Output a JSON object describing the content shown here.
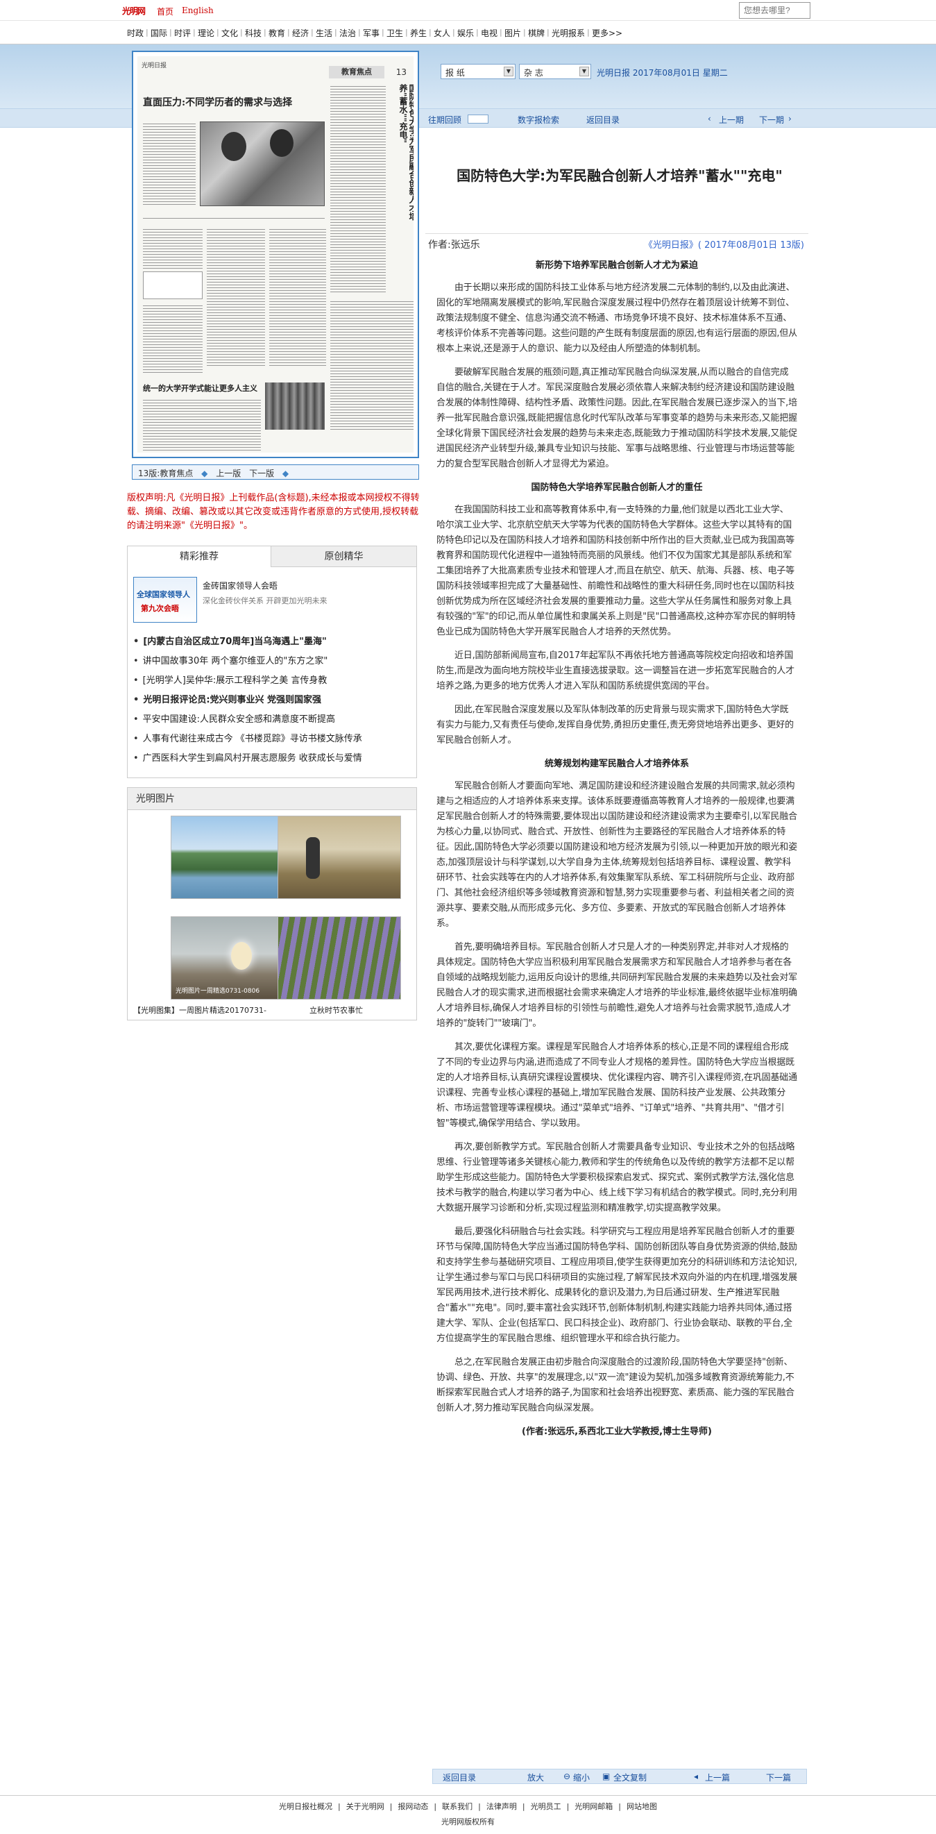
{
  "topbar": {
    "logo": "光明网",
    "links": [
      "首页",
      "English"
    ],
    "search_placeholder": "您想去哪里?"
  },
  "nav": [
    "时政",
    "国际",
    "时评",
    "理论",
    "文化",
    "科技",
    "教育",
    "经济",
    "生活",
    "法治",
    "军事",
    "卫生",
    "养生",
    "女人",
    "娱乐",
    "电视",
    "图片",
    "棋牌",
    "光明报系",
    "更多>>"
  ],
  "header": {
    "select_paper": "报  纸",
    "select_mag": "杂  志",
    "paper_date": "光明日报  2017年08月01日  星期二",
    "past_label": "往期回顾",
    "search_label": "数字报检索",
    "back_label": "返回目录",
    "prev_label": "上一期",
    "next_label": "下一期"
  },
  "paper_page": {
    "masthead": "光明日报",
    "section": "教育焦点",
    "page_num": "13",
    "headline": "直面压力:不同学历者的需求与选择",
    "vertical_title": "国防特色大学:为军民融合创新人才培养\"蓄水\"\"充电\"",
    "headline2": "统一的大学开学式能让更多人主义",
    "nav_label": "13版:教育焦点",
    "nav_prev": "上一版",
    "nav_next": "下一版"
  },
  "disclaimer": "版权声明:凡《光明日报》上刊载作品(含标题),未经本报或本网授权不得转载、摘编、改编、篡改或以其它改变或违背作者原意的方式使用,授权转载的请注明来源\"《光明日报》\"。",
  "recommend": {
    "tab_active": "精彩推荐",
    "tab_other": "原创精华",
    "feature_img_line1": "全球国家领导人",
    "feature_img_line2": "第九次会晤",
    "feature_title": "金砖国家领导人会晤",
    "feature_desc": "深化金砖伙伴关系  开辟更加光明未来",
    "items": [
      "[内蒙古自治区成立70周年]当乌海遇上\"墨海\"",
      "讲中国故事30年 两个塞尔维亚人的\"东方之家\"",
      "[光明学人]吴仲华:展示工程科学之美  言传身教",
      "光明日报评论员:党兴则事业兴  党强则国家强",
      "平安中国建设:人民群众安全感和满意度不断提高",
      "人事有代谢往来成古今 《书楼觅踪》寻访书楼文脉传承",
      "广西医科大学生到扁风村开展志愿服务  收获成长与爱情"
    ]
  },
  "photos": {
    "header": "光明图片",
    "caption3": "【光明图集】一周图片精选20170731-",
    "caption4": "立秋时节农事忙",
    "overlay3": "光明图片一周精选0731-0806"
  },
  "article": {
    "title": "国防特色大学:为军民融合创新人才培养\"蓄水\"\"充电\"",
    "author": "作者:张远乐",
    "source": "《光明日报》( 2017年08月01日  13版)",
    "blocks": [
      {
        "t": "sub",
        "text": "新形势下培养军民融合创新人才尤为紧迫"
      },
      {
        "t": "p",
        "text": "由于长期以来形成的国防科技工业体系与地方经济发展二元体制的制约,以及由此演进、固化的军地隔离发展模式的影响,军民融合深度发展过程中仍然存在着顶层设计统筹不到位、政策法规制度不健全、信息沟通交流不畅通、市场竞争环境不良好、技术标准体系不互通、考核评价体系不完善等问题。这些问题的产生既有制度层面的原因,也有运行层面的原因,但从根本上来说,还是源于人的意识、能力以及经由人所塑造的体制机制。"
      },
      {
        "t": "p",
        "text": "要破解军民融合发展的瓶颈问题,真正推动军民融合向纵深发展,从而以融合的自信完成自信的融合,关键在于人才。军民深度融合发展必须依靠人来解决制约经济建设和国防建设融合发展的体制性障碍、结构性矛盾、政策性问题。因此,在军民融合发展已逐步深入的当下,培养一批军民融合意识强,既能把握信息化时代军队改革与军事变革的趋势与未来形态,又能把握全球化背景下国民经济社会发展的趋势与未来走态,既能致力于推动国防科学技术发展,又能促进国民经济产业转型升级,兼具专业知识与技能、军事与战略思维、行业管理与市场运营等能力的复合型军民融合创新人才显得尤为紧迫。"
      },
      {
        "t": "sub",
        "text": "国防特色大学培养军民融合创新人才的重任"
      },
      {
        "t": "p",
        "text": "在我国国防科技工业和高等教育体系中,有一支特殊的力量,他们就是以西北工业大学、哈尔滨工业大学、北京航空航天大学等为代表的国防特色大学群体。这些大学以其特有的国防特色印记以及在国防科技人才培养和国防科技创新中所作出的巨大贡献,业已成为我国高等教育界和国防现代化进程中一道独特而亮丽的风景线。他们不仅为国家尤其是部队系统和军工集团培养了大批高素质专业技术和管理人才,而且在航空、航天、航海、兵器、核、电子等国防科技领域率担完成了大量基础性、前瞻性和战略性的重大科研任务,同时也在以国防科技创新优势成为所在区域经济社会发展的重要推动力量。这些大学从任务属性和服务对象上具有较强的\"军\"的印记,而从单位属性和隶属关系上则是\"民\"口普通高校,这种亦军亦民的鲜明特色业已成为国防特色大学开展军民融合人才培养的天然优势。"
      },
      {
        "t": "p",
        "text": "近日,国防部新闻局宣布,自2017年起军队不再依托地方普通高等院校定向招收和培养国防生,而是改为面向地方院校毕业生直接选拔录取。这一调整旨在进一步拓宽军民融合的人才培养之路,为更多的地方优秀人才进入军队和国防系统提供宽阔的平台。"
      },
      {
        "t": "p",
        "text": "因此,在军民融合深度发展以及军队体制改革的历史背景与现实需求下,国防特色大学既有实力与能力,又有责任与使命,发挥自身优势,勇担历史重任,责无旁贷地培养出更多、更好的军民融合创新人才。"
      },
      {
        "t": "sub",
        "text": "统筹规划构建军民融合人才培养体系"
      },
      {
        "t": "p",
        "text": "军民融合创新人才要面向军地、满足国防建设和经济建设融合发展的共同需求,就必须构建与之相适应的人才培养体系来支撑。该体系既要遵循高等教育人才培养的一般规律,也要满足军民融合创新人才的特殊需要,要体现出以国防建设和经济建设需求为主要牵引,以军民融合为核心力量,以协同式、融合式、开放性、创新性为主要路径的军民融合人才培养体系的特征。因此,国防特色大学必须要以国防建设和地方经济发展为引领,以一种更加开放的眼光和姿态,加强顶层设计与科学谋划,以大学自身为主体,统筹规划包括培养目标、课程设置、教学科研环节、社会实践等在内的人才培养体系,有效集聚军队系统、军工科研院所与企业、政府部门、其他社会经济组织等多领域教育资源和智慧,努力实现重要参与者、利益相关者之间的资源共享、要素交融,从而形成多元化、多方位、多要素、开放式的军民融合创新人才培养体系。"
      },
      {
        "t": "p",
        "text": "首先,要明确培养目标。军民融合创新人才只是人才的一种类别界定,并非对人才规格的具体规定。国防特色大学应当积极利用军民融合发展需求方和军民融合人才培养参与者在各自领域的战略规划能力,运用反向设计的思维,共同研判军民融合发展的未来趋势以及社会对军民融合人才的现实需求,进而根据社会需求来确定人才培养的毕业标准,最终依据毕业标准明确人才培养目标,确保人才培养目标的引领性与前瞻性,避免人才培养与社会需求脱节,造成人才培养的\"旋转门\"\"玻璃门\"。"
      },
      {
        "t": "p",
        "text": "其次,要优化课程方案。课程是军民融合人才培养体系的核心,正是不同的课程组合形成了不同的专业边界与内涵,进而造成了不同专业人才规格的差异性。国防特色大学应当根据既定的人才培养目标,认真研究课程设置模块、优化课程内容、聘齐引入课程师资,在巩固基础通识课程、完善专业核心课程的基础上,增加军民融合发展、国防科技产业发展、公共政策分析、市场运营管理等课程模块。通过\"菜单式\"培养、\"订单式\"培养、\"共育共用\"、\"借才引智\"等模式,确保学用结合、学以致用。"
      },
      {
        "t": "p",
        "text": "再次,要创新教学方式。军民融合创新人才需要具备专业知识、专业技术之外的包括战略思维、行业管理等诸多关键核心能力,教师和学生的传统角色以及传统的教学方法都不足以帮助学生形成这些能力。国防特色大学要积极探索启发式、探究式、案例式教学方法,强化信息技术与教学的融合,构建以学习者为中心、线上线下学习有机结合的教学模式。同时,充分利用大数据开展学习诊断和分析,实现过程监测和精准教学,切实提高教学效果。"
      },
      {
        "t": "p",
        "text": "最后,要强化科研融合与社会实践。科学研究与工程应用是培养军民融合创新人才的重要环节与保障,国防特色大学应当通过国防特色学科、国防创新团队等自身优势资源的供给,鼓励和支持学生参与基础研究项目、工程应用项目,使学生获得更加充分的科研训练和方法论知识,让学生通过参与军口与民口科研项目的实施过程,了解军民技术双向外溢的内在机理,增强发展军民两用技术,进行技术孵化、成果转化的意识及潜力,为日后通过研发、生产推进军民融合\"蓄水\"\"充电\"。同时,要丰富社会实践环节,创新体制机制,构建实践能力培养共同体,通过搭建大学、军队、企业(包括军口、民口科技企业)、政府部门、行业协会联动、联教的平台,全方位提高学生的军民融合思维、组织管理水平和综合执行能力。"
      },
      {
        "t": "p",
        "text": "总之,在军民融合发展正由初步融合向深度融合的过渡阶段,国防特色大学要坚持\"创新、协调、绿色、开放、共享\"的发展理念,以\"双一流\"建设为契机,加强多域教育资源统筹能力,不断探索军民融合式人才培养的路子,为国家和社会培养出视野宽、素质高、能力强的军民融合创新人才,努力推动军民融合向纵深发展。"
      },
      {
        "t": "sign",
        "text": "(作者:张远乐,系西北工业大学教授,博士生导师)"
      }
    ]
  },
  "toolbar": {
    "back": "返回目录",
    "enlarge": "放大",
    "shrink": "缩小",
    "copy": "全文复制",
    "prev": "上一篇",
    "next": "下一篇"
  },
  "footer": {
    "links": [
      "光明日报社概况",
      "关于光明网",
      "报网动态",
      "联系我们",
      "法律声明",
      "光明员工",
      "光明网邮箱",
      "网站地图"
    ],
    "copyright": "光明网版权所有"
  }
}
